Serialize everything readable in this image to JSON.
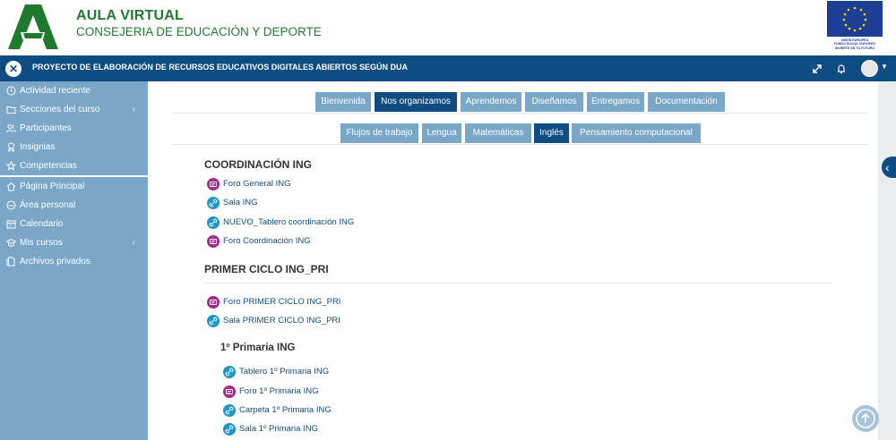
{
  "header": {
    "title": "AULA VIRTUAL",
    "subtitle": "CONSEJERIA DE EDUCACIÓN Y DEPORTE",
    "eu_lines": [
      "UNIÓN EUROPEA",
      "FONDO SOCIAL EUROPEO",
      "INVIERTE EN TU FUTURO"
    ]
  },
  "navbar": {
    "course_title": "PROYECTO DE ELABORACIÓN DE RECURSOS EDUCATIVOS DIGITALES ABIERTOS SEGÚN DUA"
  },
  "sidebar": {
    "items": [
      {
        "label": "Actividad reciente",
        "icon": "clock-icon"
      },
      {
        "label": "Secciones del curso",
        "icon": "folder-icon",
        "chevron": "‹"
      },
      {
        "label": "Participantes",
        "icon": "users-icon"
      },
      {
        "label": "Insignias",
        "icon": "badge-icon"
      },
      {
        "label": "Competencias",
        "icon": "star-icon"
      },
      {
        "label": "Página Principal",
        "icon": "home-icon"
      },
      {
        "label": "Área personal",
        "icon": "dashboard-icon"
      },
      {
        "label": "Calendario",
        "icon": "calendar-icon"
      },
      {
        "label": "Mis cursos",
        "icon": "graduation-cap-icon",
        "chevron": "‹"
      },
      {
        "label": "Archivos privados",
        "icon": "file-icon"
      }
    ]
  },
  "tabs_primary": [
    "Bienvenida",
    "Nos organizamos",
    "Aprendemos",
    "Diseñamos",
    "Entregamos",
    "Documentación"
  ],
  "tabs_secondary": [
    "Flujos de trabajo",
    "Lengua",
    "Matemáticas",
    "Inglés",
    "Pensamiento computacional"
  ],
  "content": {
    "section1_title": "COORDINACIÓN ING",
    "section1_items": [
      {
        "label": "Foro General ING",
        "type": "forum"
      },
      {
        "label": "Sala ING",
        "type": "url"
      },
      {
        "label": "NUEVO_Tablero coordinación ING",
        "type": "url"
      },
      {
        "label": "Foro Coordinación ING",
        "type": "forum"
      }
    ],
    "section2_title": "PRIMER CICLO ING_PRI",
    "section2_items": [
      {
        "label": "Foro PRIMER CICLO ING_PRI",
        "type": "forum"
      },
      {
        "label": "Sala PRIMER CICLO ING_PRI",
        "type": "url"
      }
    ],
    "sub1_title": "1º Primaria ING",
    "sub1_items": [
      {
        "label": "Tablero 1º Primaria ING",
        "type": "url"
      },
      {
        "label": "Foro 1º Primaria ING",
        "type": "forum"
      },
      {
        "label": "Carpeta 1º Primaria ING",
        "type": "url"
      },
      {
        "label": "Sala 1º Primaria ING",
        "type": "url"
      }
    ]
  },
  "colors": {
    "brand_green": "#1f7a2e",
    "navbar_blue": "#0f4c81",
    "sidebar_blue": "#7aa7c7",
    "forum_purple": "#a4288f",
    "url_cyan": "#1f95c8"
  }
}
